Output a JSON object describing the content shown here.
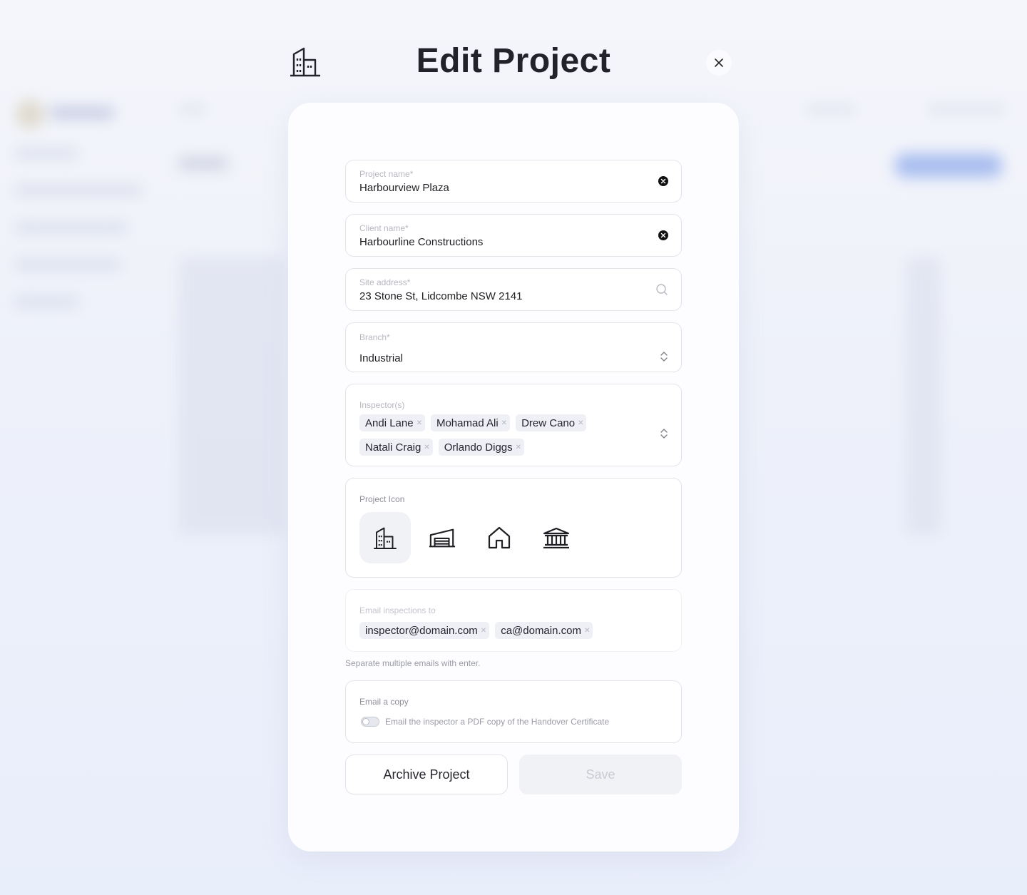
{
  "modal": {
    "title": "Edit Project",
    "header_icon": "building-icon",
    "close_icon": "close-icon"
  },
  "form": {
    "project_name": {
      "label": "Project name*",
      "value": "Harbourview Plaza",
      "icon": "clear-icon"
    },
    "client_name": {
      "label": "Client name*",
      "value": "Harbourline Constructions",
      "icon": "clear-icon"
    },
    "site_address": {
      "label": "Site address*",
      "value": "23 Stone St, Lidcombe NSW 2141",
      "icon": "search-icon"
    },
    "branch": {
      "label": "Branch*",
      "value": "Industrial",
      "icon": "chevron-updown-icon"
    },
    "inspectors": {
      "label": "Inspector(s)",
      "chips": [
        "Andi Lane",
        "Mohamad Ali",
        "Drew Cano",
        "Natali Craig",
        "Orlando Diggs"
      ],
      "icon": "chevron-updown-icon"
    },
    "project_icon": {
      "label": "Project Icon",
      "options": [
        "building-icon",
        "warehouse-icon",
        "house-icon",
        "bank-icon"
      ],
      "selected": "building-icon"
    },
    "email_inspections": {
      "label": "Email inspections to",
      "chips": [
        "inspector@domain.com",
        "ca@domain.com"
      ],
      "helper": "Separate multiple emails with enter."
    },
    "email_copy": {
      "label": "Email a copy",
      "toggle_text": "Email the inspector a PDF copy of the Handover Certificate",
      "toggle_on": false
    }
  },
  "actions": {
    "archive_label": "Archive Project",
    "save_label": "Save",
    "save_enabled": false
  },
  "colors": {
    "accent": "#6f93e6",
    "text": "#1f1f24",
    "muted": "#b7b8c1",
    "chip_bg": "#eef0f6"
  }
}
